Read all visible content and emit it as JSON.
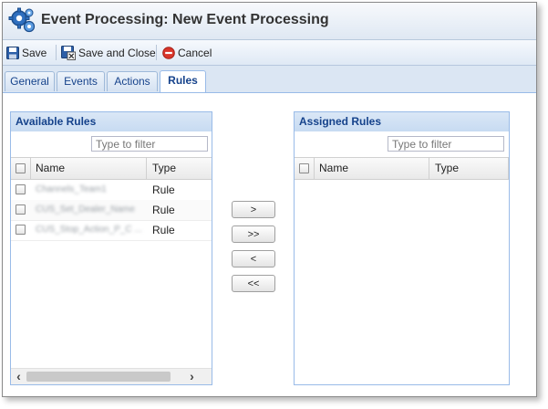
{
  "window": {
    "title": "Event Processing: New Event Processing"
  },
  "toolbar": {
    "save_label": "Save",
    "save_close_label": "Save and Close",
    "cancel_label": "Cancel"
  },
  "tabs": [
    {
      "label": "General"
    },
    {
      "label": "Events"
    },
    {
      "label": "Actions"
    },
    {
      "label": "Rules",
      "active": true
    }
  ],
  "available": {
    "title": "Available Rules",
    "filter_placeholder": "Type to filter",
    "columns": {
      "name": "Name",
      "type": "Type"
    },
    "rows": [
      {
        "name": "Channels_Team1",
        "type": "Rule"
      },
      {
        "name": "CUS_Set_Dealer_Name",
        "type": "Rule"
      },
      {
        "name": "CUS_Stop_Action_P_C ...",
        "type": "Rule"
      }
    ]
  },
  "assigned": {
    "title": "Assigned Rules",
    "filter_placeholder": "Type to filter",
    "columns": {
      "name": "Name",
      "type": "Type"
    }
  },
  "move_buttons": {
    "add": ">",
    "add_all": ">>",
    "remove": "<",
    "remove_all": "<<"
  },
  "icons": {
    "app": "gears-icon",
    "save": "floppy-disk-icon",
    "save_close": "floppy-disk-close-icon",
    "cancel": "cancel-circle-icon",
    "scroll_left": "chevron-left-icon",
    "scroll_right": "chevron-right-icon"
  },
  "colors": {
    "header_text": "#15428b",
    "panel_border": "#99bbe8",
    "cancel_red": "#d9362b"
  }
}
